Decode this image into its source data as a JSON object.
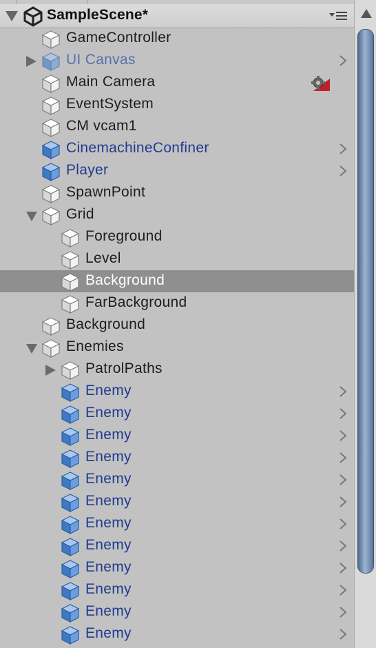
{
  "scene": {
    "title": "SampleScene*",
    "menu_icon": "dropdown-menu-icon",
    "fold_icon": "expanded-arrow-icon",
    "logo_icon": "unity-logo-icon"
  },
  "colors": {
    "prefab": "#1f3b8f",
    "prefab_inactive": "#5a6fae",
    "selection": "#8f8f8f",
    "scroll_thumb": "#6f88ad"
  },
  "hierarchy": [
    {
      "label": "GameController",
      "depth": 0,
      "kind": "object"
    },
    {
      "label": "UI Canvas",
      "depth": 0,
      "kind": "prefab-inactive",
      "toggle": "collapsed",
      "chevron": true
    },
    {
      "label": "Main Camera",
      "depth": 0,
      "kind": "object",
      "badge": "gear-icon"
    },
    {
      "label": "EventSystem",
      "depth": 0,
      "kind": "object"
    },
    {
      "label": "CM vcam1",
      "depth": 0,
      "kind": "object"
    },
    {
      "label": "CinemachineConfiner",
      "depth": 0,
      "kind": "prefab",
      "chevron": true
    },
    {
      "label": "Player",
      "depth": 0,
      "kind": "prefab",
      "chevron": true
    },
    {
      "label": "SpawnPoint",
      "depth": 0,
      "kind": "object"
    },
    {
      "label": "Grid",
      "depth": 0,
      "kind": "object",
      "toggle": "expanded"
    },
    {
      "label": "Foreground",
      "depth": 1,
      "kind": "object"
    },
    {
      "label": "Level",
      "depth": 1,
      "kind": "object"
    },
    {
      "label": "Background",
      "depth": 1,
      "kind": "object",
      "selected": true
    },
    {
      "label": "FarBackground",
      "depth": 1,
      "kind": "object"
    },
    {
      "label": "Background",
      "depth": 0,
      "kind": "object"
    },
    {
      "label": "Enemies",
      "depth": 0,
      "kind": "object",
      "toggle": "expanded"
    },
    {
      "label": "PatrolPaths",
      "depth": 1,
      "kind": "object",
      "toggle": "collapsed"
    },
    {
      "label": "Enemy",
      "depth": 1,
      "kind": "prefab",
      "chevron": true
    },
    {
      "label": "Enemy",
      "depth": 1,
      "kind": "prefab",
      "chevron": true
    },
    {
      "label": "Enemy",
      "depth": 1,
      "kind": "prefab",
      "chevron": true
    },
    {
      "label": "Enemy",
      "depth": 1,
      "kind": "prefab",
      "chevron": true
    },
    {
      "label": "Enemy",
      "depth": 1,
      "kind": "prefab",
      "chevron": true
    },
    {
      "label": "Enemy",
      "depth": 1,
      "kind": "prefab",
      "chevron": true
    },
    {
      "label": "Enemy",
      "depth": 1,
      "kind": "prefab",
      "chevron": true
    },
    {
      "label": "Enemy",
      "depth": 1,
      "kind": "prefab",
      "chevron": true
    },
    {
      "label": "Enemy",
      "depth": 1,
      "kind": "prefab",
      "chevron": true
    },
    {
      "label": "Enemy",
      "depth": 1,
      "kind": "prefab",
      "chevron": true
    },
    {
      "label": "Enemy",
      "depth": 1,
      "kind": "prefab",
      "chevron": true
    },
    {
      "label": "Enemy",
      "depth": 1,
      "kind": "prefab",
      "chevron": true
    },
    {
      "label": "",
      "depth": 1,
      "kind": "prefab"
    }
  ],
  "scrollbar": {
    "up_icon": "scroll-up-arrow-icon"
  }
}
